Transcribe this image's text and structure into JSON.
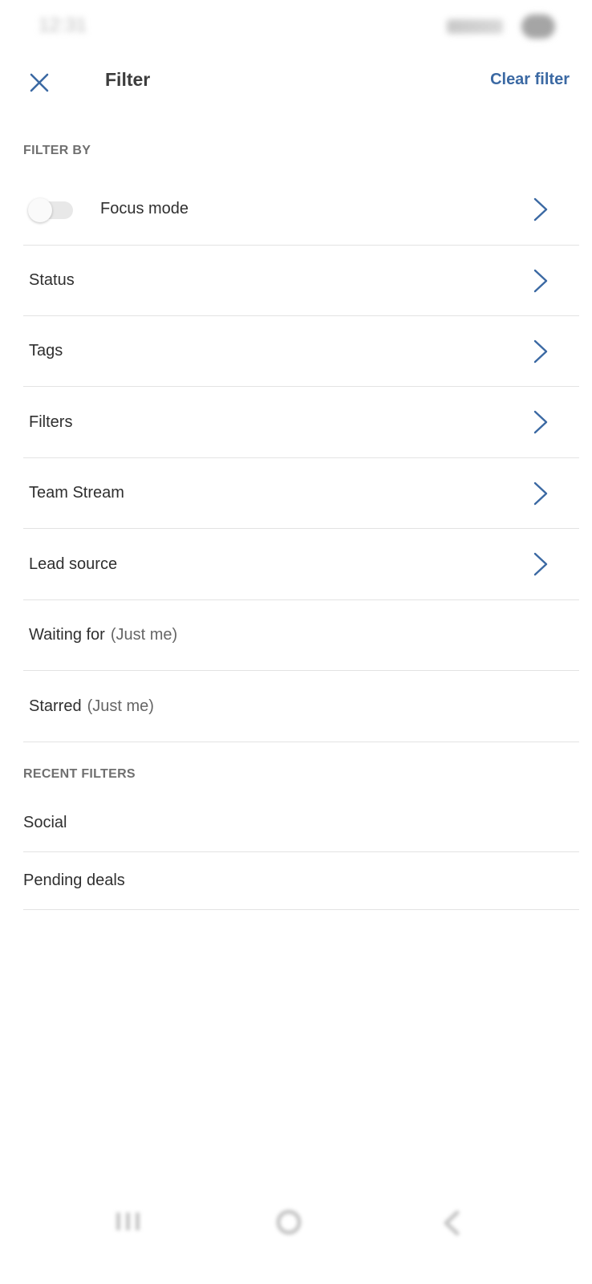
{
  "status_bar": {
    "time": "12:31"
  },
  "header": {
    "title": "Filter",
    "clear_label": "Clear filter",
    "accent_color": "#3b69a3"
  },
  "filter_by": {
    "heading": "FILTER BY",
    "focus_mode": {
      "label": "Focus mode",
      "enabled": false
    },
    "items": [
      {
        "label": "Status"
      },
      {
        "label": "Tags"
      },
      {
        "label": "Filters"
      },
      {
        "label": "Team Stream"
      },
      {
        "label": "Lead source"
      },
      {
        "label": "Waiting for",
        "sub": "(Just me)"
      },
      {
        "label": "Starred",
        "sub": "(Just me)"
      }
    ]
  },
  "recent_filters": {
    "heading": "RECENT FILTERS",
    "items": [
      {
        "label": "Social"
      },
      {
        "label": "Pending deals"
      }
    ]
  },
  "icons": {
    "close": "close-icon",
    "chevron": "chevron-right-icon",
    "nav_recents": "recents-icon",
    "nav_home": "home-icon",
    "nav_back": "back-icon"
  }
}
